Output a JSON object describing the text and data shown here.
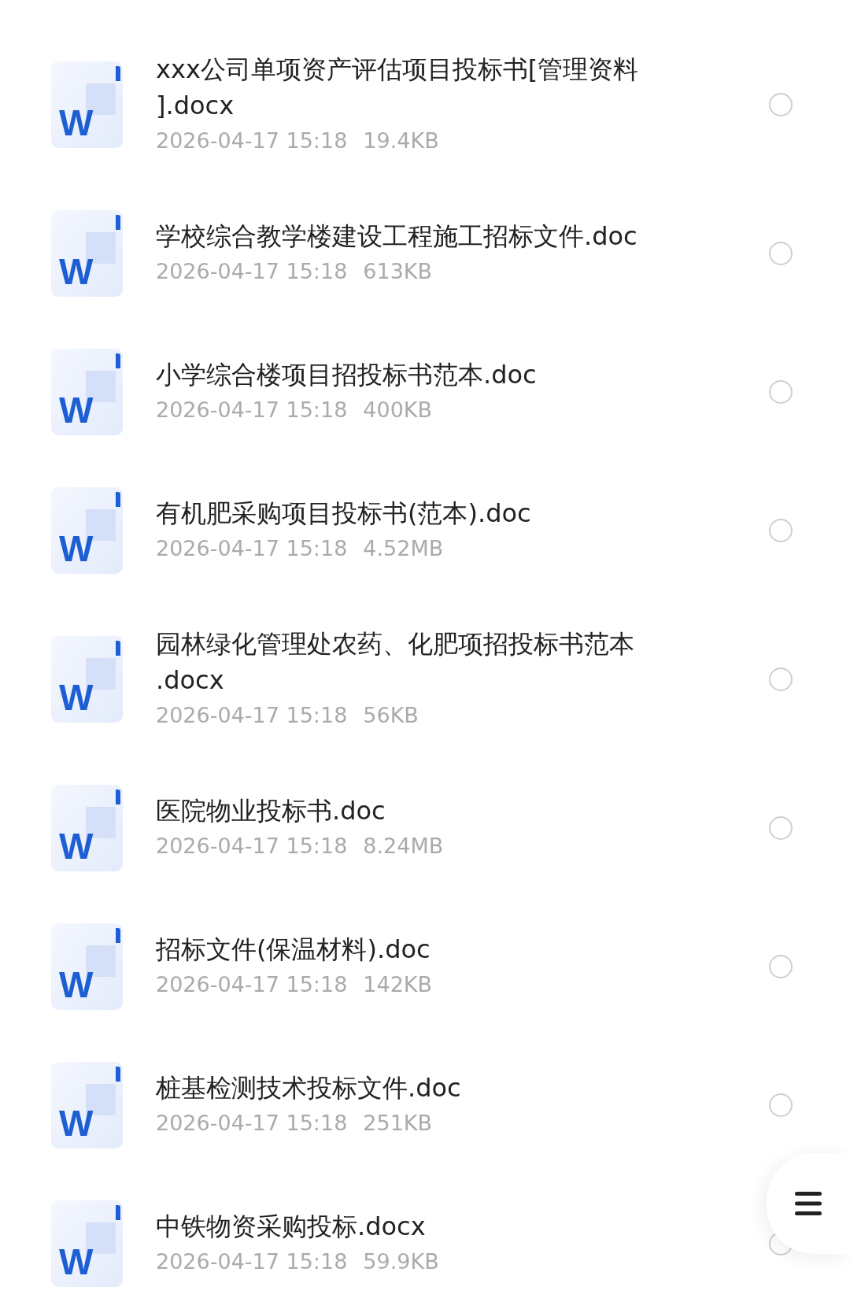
{
  "files": [
    {
      "name": "xxx公司单项资产评估项目投标书[管理资料\n].docx",
      "date": "2026-04-17 15:18",
      "size": "19.4KB",
      "icon_letter": "W",
      "selected": false
    },
    {
      "name": "学校综合教学楼建设工程施工招标文件.doc",
      "date": "2026-04-17 15:18",
      "size": "613KB",
      "icon_letter": "W",
      "selected": false
    },
    {
      "name": "小学综合楼项目招投标书范本.doc",
      "date": "2026-04-17 15:18",
      "size": "400KB",
      "icon_letter": "W",
      "selected": false
    },
    {
      "name": "有机肥采购项目投标书(范本).doc",
      "date": "2026-04-17 15:18",
      "size": "4.52MB",
      "icon_letter": "W",
      "selected": false
    },
    {
      "name": "园林绿化管理处农药、化肥项招投标书范本\n.docx",
      "date": "2026-04-17 15:18",
      "size": "56KB",
      "icon_letter": "W",
      "selected": false
    },
    {
      "name": "医院物业投标书.doc",
      "date": "2026-04-17 15:18",
      "size": "8.24MB",
      "icon_letter": "W",
      "selected": false
    },
    {
      "name": "招标文件(保温材料).doc",
      "date": "2026-04-17 15:18",
      "size": "142KB",
      "icon_letter": "W",
      "selected": false
    },
    {
      "name": "桩基检测技术投标文件.doc",
      "date": "2026-04-17 15:18",
      "size": "251KB",
      "icon_letter": "W",
      "selected": false
    },
    {
      "name": "中铁物资采购投标.docx",
      "date": "2026-04-17 15:18",
      "size": "59.9KB",
      "icon_letter": "W",
      "selected": false
    }
  ]
}
